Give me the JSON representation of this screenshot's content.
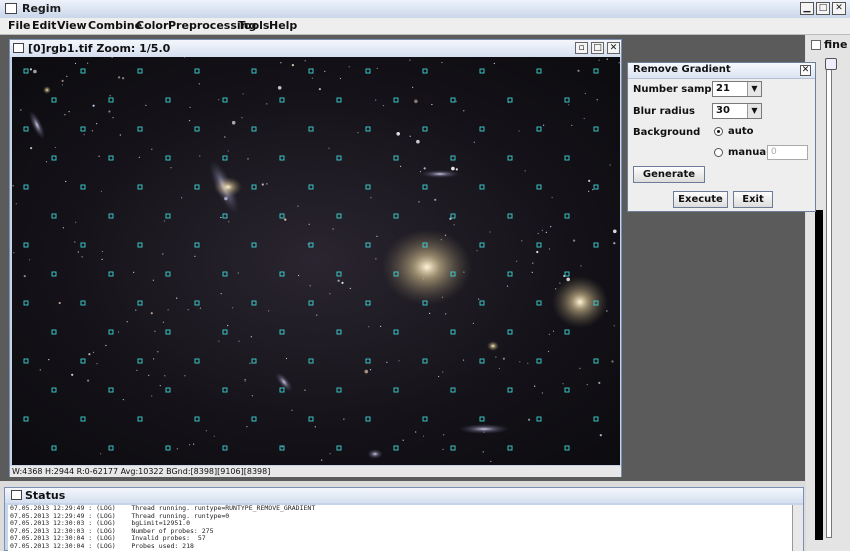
{
  "app": {
    "title": "Regim"
  },
  "menu": [
    "File",
    "Edit",
    "View",
    "Combine",
    "Color",
    "Preprocessing",
    "Tools",
    "Help"
  ],
  "image_window": {
    "title": "[0]rgb1.tif  Zoom: 1/5.0",
    "info": "W:4368 H:2944 R:0-62177 Avg:10322 BGnd:[8398][9106][8398]"
  },
  "side": {
    "fine_label": "fine"
  },
  "dialog": {
    "title": "Remove Gradient",
    "samples_label": "Number samples",
    "samples_value": "21",
    "blur_label": "Blur radius",
    "blur_value": "30",
    "background_label": "Background",
    "auto_label": "auto",
    "manual_label": "manual",
    "manual_value": "0",
    "generate_label": "Generate",
    "execute_label": "Execute",
    "exit_label": "Exit"
  },
  "status": {
    "title": "Status",
    "log": [
      "07.05.2013 12:29:49 : (LOG)    Thread running. runtype=RUNTYPE_REMOVE_GRADIENT",
      "07.05.2013 12:29:49 : (LOG)    Thread running. runtype=0",
      "07.05.2013 12:30:03 : (LOG)    bgLimit=12951.0",
      "07.05.2013 12:30:03 : (LOG)    Number of probes: 275",
      "07.05.2013 12:30:04 : (LOG)    Invalid probes:  57",
      "07.05.2013 12:30:04 : (LOG)    Probes used: 218"
    ]
  },
  "colors": {
    "sample_marker": "#3fd6d6",
    "desktop": "#5b5b5b",
    "frame": "#c6d4ea"
  }
}
